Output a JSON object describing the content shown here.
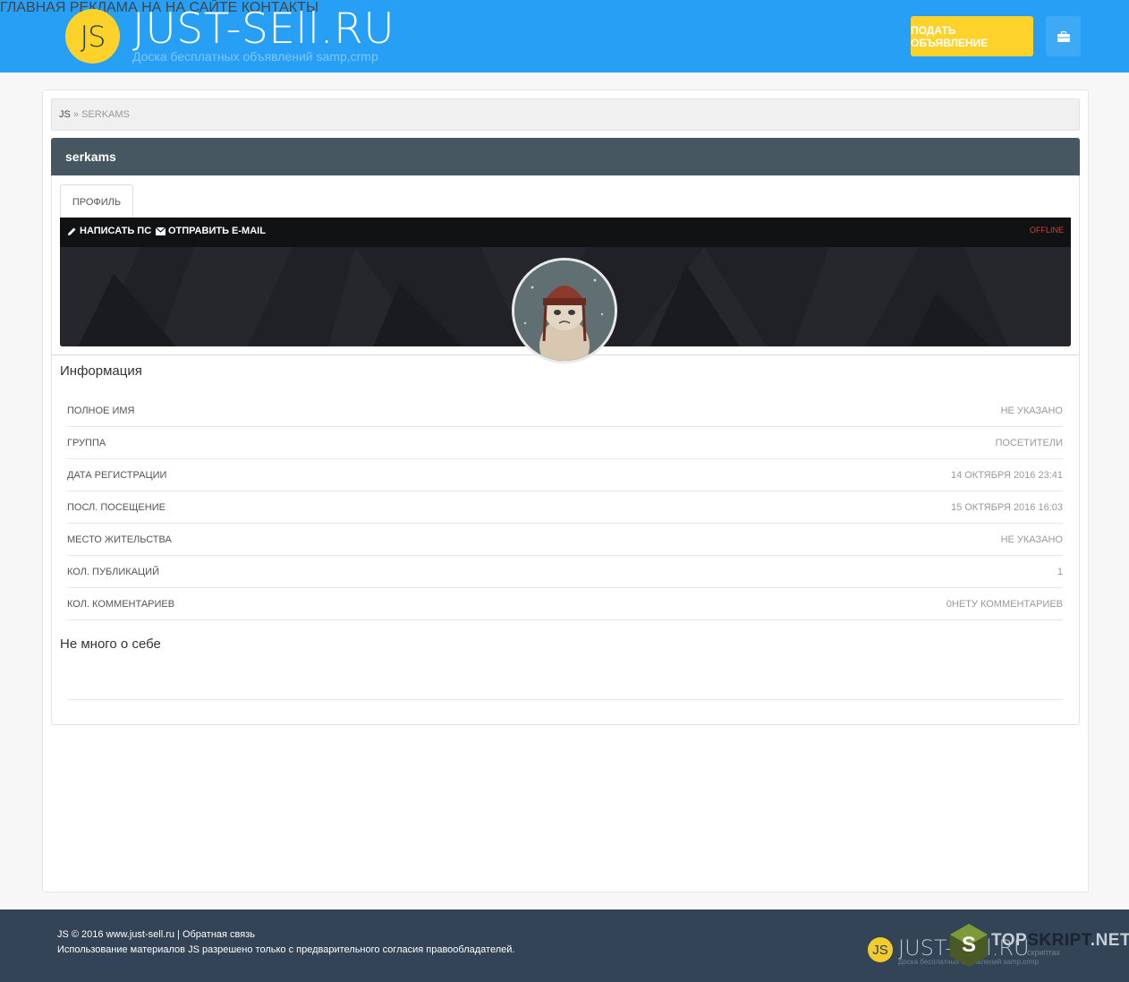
{
  "header": {
    "logo_mark": "JS",
    "logo_title": "JUST-SEll.RU",
    "logo_subtitle": "Доска бесплатных объявлений samp,crmp",
    "nav": [
      "ГЛАВНАЯ",
      "РЕКЛАМА НА НА САЙТЕ",
      "КОНТАКТЫ"
    ],
    "cta_label": "ПОДАТЬ ОБЪЯВЛЕНИЕ",
    "menu_icon": "briefcase-icon",
    "bg_color": "#279ff5",
    "cta_color": "#fdd32b"
  },
  "breadcrumb": {
    "home": "JS",
    "separator": "»",
    "current": "serkams"
  },
  "profile": {
    "username": "serkams",
    "tab_label": "ПРОФИЛЬ",
    "action_pm": "НАПИСАТЬ ПС",
    "action_email": "ОТПРАВИТЬ E-MAIL",
    "status": "OFFLINE",
    "pm_icon": "pencil-icon",
    "email_icon": "envelope-icon"
  },
  "info": {
    "title": "Информация",
    "rows": [
      {
        "label": "ПОЛНОЕ ИМЯ",
        "value": "НЕ УКАЗАНО"
      },
      {
        "label": "ГРУППА",
        "value": "ПОСЕТИТЕЛИ"
      },
      {
        "label": "ДАТА РЕГИСТРАЦИИ",
        "value": "14 ОКТЯБРЯ 2016 23:41"
      },
      {
        "label": "ПОСЛ. ПОСЕЩЕНИЕ",
        "value": "15 ОКТЯБРЯ 2016 16:03"
      },
      {
        "label": "МЕСТО ЖИТЕЛЬСТВА",
        "value": "НЕ УКАЗАНО"
      },
      {
        "label": "КОЛ. ПУБЛИКАЦИЙ",
        "value": "1"
      },
      {
        "label": "КОЛ. КОММЕНТАРИЕВ",
        "value": "0НЕТУ КОММЕНТАРИЕВ"
      }
    ]
  },
  "about": {
    "title": "Не много о себе"
  },
  "footer": {
    "line1": "JS © 2016 www.just-sell.ru | Обратная связь",
    "line2": "Использование материалов JS разрешено только с предварительного согласия правообладателей.",
    "logo_mark": "JS",
    "logo_title": "JUST-SEll.RU",
    "logo_subtitle": "Доска бесплатных объявлений samp,crmp"
  },
  "watermark": {
    "letter": "S",
    "part1": "TOP",
    "part2": "SKRIPT",
    "part3": ".NET",
    "sub": "скриптах"
  }
}
